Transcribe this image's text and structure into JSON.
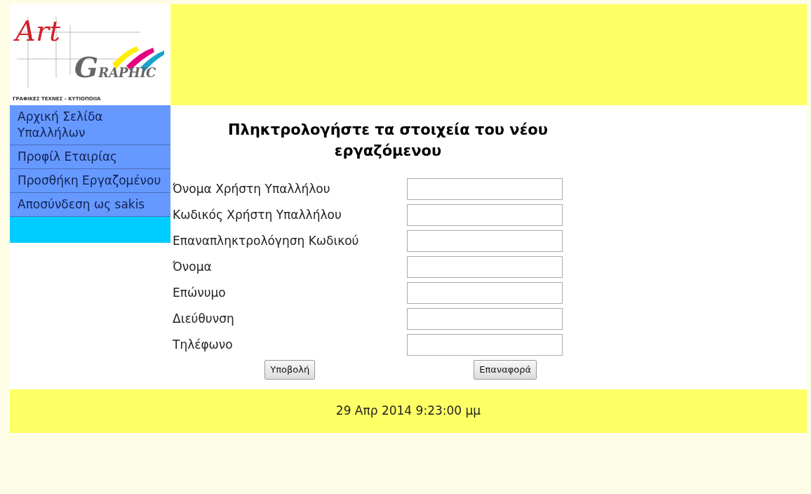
{
  "logo": {
    "script": "Art",
    "word": "GRAPHIC",
    "tagline": "ΓΡΑΦΙΚΕΣ ΤΕΧΝΕΣ - ΚΥΤΙΟΠΟΙΙΑ"
  },
  "sidebar": {
    "items": [
      {
        "label": "Αρχική Σελίδα Υπαλλήλων"
      },
      {
        "label": "Προφίλ Εταιρίας"
      },
      {
        "label": "Προσθήκη Εργαζομένου"
      },
      {
        "label": "Αποσύνδεση ως sakis"
      }
    ]
  },
  "form": {
    "title": "Πληκτρολογήστε τα στοιχεία του νέου εργαζόμενου",
    "fields": [
      {
        "label": "Όνομα Χρήστη Υπαλλήλου"
      },
      {
        "label": "Κωδικός Χρήστη Υπαλλήλου"
      },
      {
        "label": "Επαναπληκτρολόγηση Κωδικού"
      },
      {
        "label": "Όνομα"
      },
      {
        "label": "Επώνυμο"
      },
      {
        "label": "Διεύθυνση"
      },
      {
        "label": "Τηλέφωνο"
      }
    ],
    "buttons": [
      "Υποβολή",
      "Επαναφορά"
    ]
  },
  "footer": {
    "datetime": "29 Απρ 2014 9:23:00 μμ"
  }
}
